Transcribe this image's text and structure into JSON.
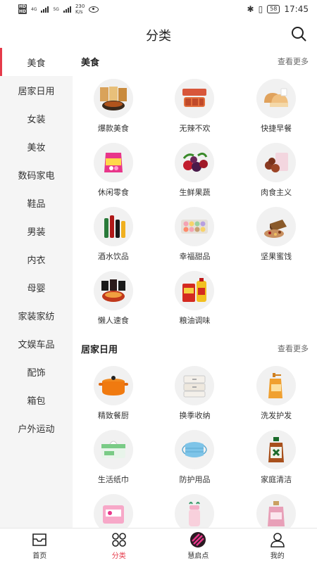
{
  "status_bar": {
    "sim1": "HD",
    "sim2": "HD",
    "net1": "4G",
    "net2": "5G",
    "speed_value": "230",
    "speed_unit": "K/s",
    "battery": "58",
    "time": "17:45"
  },
  "header": {
    "title": "分类"
  },
  "sidebar": {
    "items": [
      {
        "label": "美食"
      },
      {
        "label": "居家日用"
      },
      {
        "label": "女装"
      },
      {
        "label": "美妆"
      },
      {
        "label": "数码家电"
      },
      {
        "label": "鞋品"
      },
      {
        "label": "男装"
      },
      {
        "label": "内衣"
      },
      {
        "label": "母婴"
      },
      {
        "label": "家装家纺"
      },
      {
        "label": "文娱车品"
      },
      {
        "label": "配饰"
      },
      {
        "label": "箱包"
      },
      {
        "label": "户外运动"
      }
    ]
  },
  "sections": [
    {
      "title": "美食",
      "more": "查看更多",
      "items": [
        {
          "label": "爆款美食",
          "icon": "snack-pack-icon"
        },
        {
          "label": "无辣不欢",
          "icon": "spicy-meat-icon"
        },
        {
          "label": "快捷早餐",
          "icon": "bread-icon"
        },
        {
          "label": "休闲零食",
          "icon": "candy-bag-icon"
        },
        {
          "label": "生鲜果蔬",
          "icon": "berries-icon"
        },
        {
          "label": "肉食主义",
          "icon": "meatballs-icon"
        },
        {
          "label": "酒水饮品",
          "icon": "bottles-icon"
        },
        {
          "label": "幸福甜品",
          "icon": "macaron-icon"
        },
        {
          "label": "坚果蜜饯",
          "icon": "nuts-icon"
        },
        {
          "label": "懒人速食",
          "icon": "instant-noodle-icon"
        },
        {
          "label": "粮油调味",
          "icon": "oil-rice-icon"
        }
      ]
    },
    {
      "title": "居家日用",
      "more": "查看更多",
      "items": [
        {
          "label": "精致餐厨",
          "icon": "pot-icon"
        },
        {
          "label": "换季收纳",
          "icon": "storage-box-icon"
        },
        {
          "label": "洗发护发",
          "icon": "shampoo-icon"
        },
        {
          "label": "生活纸巾",
          "icon": "tissue-icon"
        },
        {
          "label": "防护用品",
          "icon": "mask-icon"
        },
        {
          "label": "家庭清洁",
          "icon": "cleaner-bottle-icon"
        },
        {
          "label": "",
          "icon": "pink-pack-icon"
        },
        {
          "label": "",
          "icon": "baby-bottle-icon"
        },
        {
          "label": "",
          "icon": "perfume-icon"
        }
      ]
    }
  ],
  "bottom_nav": [
    {
      "label": "首页",
      "icon": "home-icon"
    },
    {
      "label": "分类",
      "icon": "category-icon"
    },
    {
      "label": "慧启点",
      "icon": "brand-icon"
    },
    {
      "label": "我的",
      "icon": "user-icon"
    }
  ],
  "colors": {
    "accent": "#e53a4a",
    "sidebar_bg": "#f5f5f5"
  }
}
